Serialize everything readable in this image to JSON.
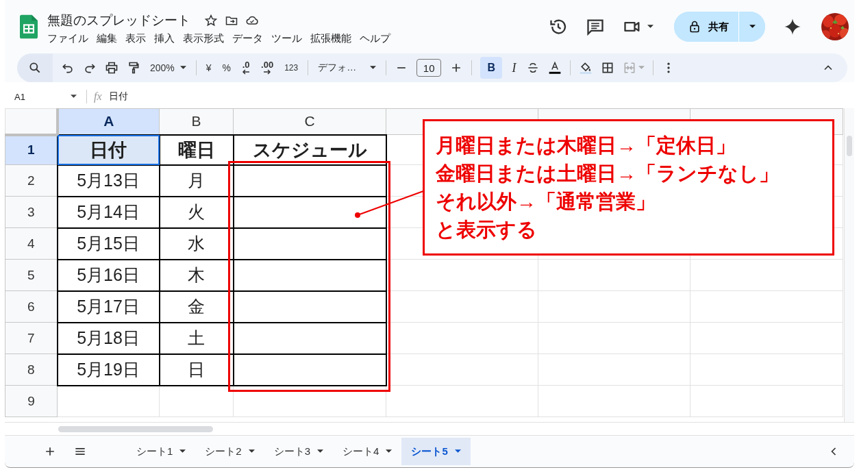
{
  "title": "無題のスプレッドシート",
  "menu": [
    "ファイル",
    "編集",
    "表示",
    "挿入",
    "表示形式",
    "データ",
    "ツール",
    "拡張機能",
    "ヘルプ"
  ],
  "share_button": "共有",
  "toolbar": {
    "zoom": "200%",
    "currency": "¥",
    "percent": "%",
    "decimal_decrease": ".0",
    "decimal_increase": ".00",
    "number_format": "123",
    "font": "デフォ…",
    "font_size": "10",
    "bold": {
      "label": "B",
      "selected": true
    },
    "italic": "I"
  },
  "name_box": "A1",
  "formula_icon": "fx",
  "formula": "日付",
  "columns": [
    {
      "label": "A",
      "selected": true
    },
    {
      "label": "B",
      "selected": false
    },
    {
      "label": "C",
      "selected": false
    }
  ],
  "rows": [
    {
      "number": "1",
      "selected": true,
      "cells": [
        "日付",
        "曜日",
        "スケジュール"
      ]
    },
    {
      "number": "2",
      "selected": false,
      "cells": [
        "5月13日",
        "月"
      ]
    },
    {
      "number": "3",
      "selected": false,
      "cells": [
        "5月14日",
        "火"
      ]
    },
    {
      "number": "4",
      "selected": false,
      "cells": [
        "5月15日",
        "水"
      ]
    },
    {
      "number": "5",
      "selected": false,
      "cells": [
        "5月16日",
        "木"
      ]
    },
    {
      "number": "6",
      "selected": false,
      "cells": [
        "5月17日",
        "金"
      ]
    },
    {
      "number": "7",
      "selected": false,
      "cells": [
        "5月18日",
        "土"
      ]
    },
    {
      "number": "8",
      "selected": false,
      "cells": [
        "5月19日",
        "日"
      ]
    },
    {
      "number": "9",
      "selected": false
    }
  ],
  "callout": [
    "月曜日または木曜日→「定休日」",
    "金曜日または土曜日→「ランチなし」",
    "それ以外→「通常営業」",
    "と表示する"
  ],
  "sheets": [
    {
      "label": "シート1",
      "selected": false
    },
    {
      "label": "シート2",
      "selected": false
    },
    {
      "label": "シート3",
      "selected": false
    },
    {
      "label": "シート4",
      "selected": false
    },
    {
      "label": "シート5",
      "selected": true
    }
  ]
}
